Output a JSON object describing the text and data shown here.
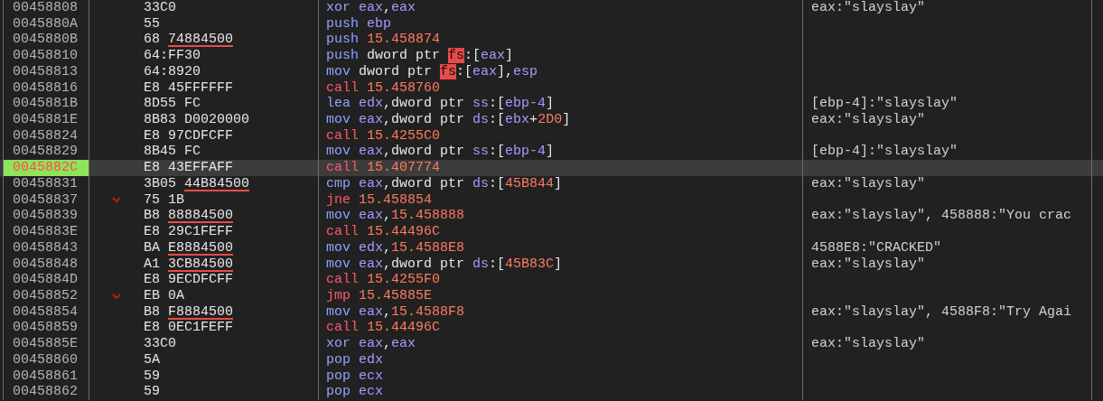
{
  "rows": [
    {
      "address": "00458808",
      "jump": false,
      "eip": false,
      "selected": false,
      "bytes": "33C0",
      "tokens": [
        {
          "kind": "mnem",
          "text": "xor "
        },
        {
          "kind": "reg",
          "text": "eax"
        },
        {
          "kind": "punct",
          "text": ","
        },
        {
          "kind": "reg",
          "text": "eax"
        }
      ],
      "comment": "eax:\"slayslay\""
    },
    {
      "address": "0045880A",
      "jump": false,
      "eip": false,
      "selected": false,
      "bytes": "55",
      "tokens": [
        {
          "kind": "mnem",
          "text": "push "
        },
        {
          "kind": "reg",
          "text": "ebp"
        }
      ]
    },
    {
      "address": "0045880B",
      "jump": false,
      "eip": false,
      "selected": false,
      "bytes": "68 ",
      "reloc": "74884500",
      "tokens": [
        {
          "kind": "mnem",
          "text": "push "
        },
        {
          "kind": "num",
          "text": "15.458874"
        }
      ]
    },
    {
      "address": "00458810",
      "jump": false,
      "eip": false,
      "selected": false,
      "bytes": "64:FF30",
      "tokens": [
        {
          "kind": "mnem",
          "text": "push "
        },
        {
          "kind": "ptr",
          "text": "dword ptr "
        },
        {
          "kind": "seg_alert",
          "text": "fs"
        },
        {
          "kind": "punct",
          "text": ":["
        },
        {
          "kind": "reg",
          "text": "eax"
        },
        {
          "kind": "punct",
          "text": "]"
        }
      ]
    },
    {
      "address": "00458813",
      "jump": false,
      "eip": false,
      "selected": false,
      "bytes": "64:8920",
      "tokens": [
        {
          "kind": "mnem",
          "text": "mov "
        },
        {
          "kind": "ptr",
          "text": "dword ptr "
        },
        {
          "kind": "seg_alert",
          "text": "fs"
        },
        {
          "kind": "punct",
          "text": ":["
        },
        {
          "kind": "reg",
          "text": "eax"
        },
        {
          "kind": "punct",
          "text": "],"
        },
        {
          "kind": "reg",
          "text": "esp"
        }
      ]
    },
    {
      "address": "00458816",
      "jump": false,
      "eip": false,
      "selected": false,
      "bytes": "E8 45FFFFFF",
      "tokens": [
        {
          "kind": "branch",
          "text": "call "
        },
        {
          "kind": "num",
          "text": "15.458760"
        }
      ]
    },
    {
      "address": "0045881B",
      "jump": false,
      "eip": false,
      "selected": false,
      "bytes": "8D55 FC",
      "tokens": [
        {
          "kind": "mnem",
          "text": "lea "
        },
        {
          "kind": "reg",
          "text": "edx"
        },
        {
          "kind": "punct",
          "text": ","
        },
        {
          "kind": "ptr",
          "text": "dword ptr "
        },
        {
          "kind": "seg",
          "text": "ss"
        },
        {
          "kind": "punct",
          "text": ":["
        },
        {
          "kind": "reg",
          "text": "ebp-4"
        },
        {
          "kind": "punct",
          "text": "]"
        }
      ],
      "comment": "[ebp-4]:\"slayslay\""
    },
    {
      "address": "0045881E",
      "jump": false,
      "eip": false,
      "selected": false,
      "bytes": "8B83 D0020000",
      "tokens": [
        {
          "kind": "mnem",
          "text": "mov "
        },
        {
          "kind": "reg",
          "text": "eax"
        },
        {
          "kind": "punct",
          "text": ","
        },
        {
          "kind": "ptr",
          "text": "dword ptr "
        },
        {
          "kind": "seg",
          "text": "ds"
        },
        {
          "kind": "punct",
          "text": ":["
        },
        {
          "kind": "reg",
          "text": "ebx"
        },
        {
          "kind": "punct",
          "text": "+"
        },
        {
          "kind": "num",
          "text": "2D0"
        },
        {
          "kind": "punct",
          "text": "]"
        }
      ],
      "comment": "eax:\"slayslay\""
    },
    {
      "address": "00458824",
      "jump": false,
      "eip": false,
      "selected": false,
      "bytes": "E8 97CDFCFF",
      "tokens": [
        {
          "kind": "branch",
          "text": "call "
        },
        {
          "kind": "num",
          "text": "15.4255C0"
        }
      ]
    },
    {
      "address": "00458829",
      "jump": false,
      "eip": false,
      "selected": false,
      "bytes": "8B45 FC",
      "tokens": [
        {
          "kind": "mnem",
          "text": "mov "
        },
        {
          "kind": "reg",
          "text": "eax"
        },
        {
          "kind": "punct",
          "text": ","
        },
        {
          "kind": "ptr",
          "text": "dword ptr "
        },
        {
          "kind": "seg",
          "text": "ss"
        },
        {
          "kind": "punct",
          "text": ":["
        },
        {
          "kind": "reg",
          "text": "ebp-4"
        },
        {
          "kind": "punct",
          "text": "]"
        }
      ],
      "comment": "[ebp-4]:\"slayslay\""
    },
    {
      "address": "0045882C",
      "jump": false,
      "eip": true,
      "selected": true,
      "bytes": "E8 43EFFAFF",
      "tokens": [
        {
          "kind": "branch",
          "text": "call "
        },
        {
          "kind": "num",
          "text": "15.407774"
        }
      ]
    },
    {
      "address": "00458831",
      "jump": false,
      "eip": false,
      "selected": false,
      "bytes": "3B05 ",
      "reloc": "44B84500",
      "tokens": [
        {
          "kind": "mnem",
          "text": "cmp "
        },
        {
          "kind": "reg",
          "text": "eax"
        },
        {
          "kind": "punct",
          "text": ","
        },
        {
          "kind": "ptr",
          "text": "dword ptr "
        },
        {
          "kind": "seg",
          "text": "ds"
        },
        {
          "kind": "punct",
          "text": ":["
        },
        {
          "kind": "num",
          "text": "45B844"
        },
        {
          "kind": "punct",
          "text": "]"
        }
      ],
      "comment": "eax:\"slayslay\""
    },
    {
      "address": "00458837",
      "jump": true,
      "eip": false,
      "selected": false,
      "bytes": "75 1B",
      "tokens": [
        {
          "kind": "branch",
          "text": "jne "
        },
        {
          "kind": "num",
          "text": "15.458854"
        }
      ]
    },
    {
      "address": "00458839",
      "jump": false,
      "eip": false,
      "selected": false,
      "bytes": "B8 ",
      "reloc": "88884500",
      "tokens": [
        {
          "kind": "mnem",
          "text": "mov "
        },
        {
          "kind": "reg",
          "text": "eax"
        },
        {
          "kind": "punct",
          "text": ","
        },
        {
          "kind": "num",
          "text": "15.458888"
        }
      ],
      "comment": "eax:\"slayslay\", 458888:\"You crac"
    },
    {
      "address": "0045883E",
      "jump": false,
      "eip": false,
      "selected": false,
      "bytes": "E8 29C1FEFF",
      "tokens": [
        {
          "kind": "branch",
          "text": "call "
        },
        {
          "kind": "num",
          "text": "15.44496C"
        }
      ]
    },
    {
      "address": "00458843",
      "jump": false,
      "eip": false,
      "selected": false,
      "bytes": "BA ",
      "reloc": "E8884500",
      "tokens": [
        {
          "kind": "mnem",
          "text": "mov "
        },
        {
          "kind": "reg",
          "text": "edx"
        },
        {
          "kind": "punct",
          "text": ","
        },
        {
          "kind": "num",
          "text": "15.4588E8"
        }
      ],
      "comment": "4588E8:\"CRACKED\""
    },
    {
      "address": "00458848",
      "jump": false,
      "eip": false,
      "selected": false,
      "bytes": "A1 ",
      "reloc": "3CB84500",
      "tokens": [
        {
          "kind": "mnem",
          "text": "mov "
        },
        {
          "kind": "reg",
          "text": "eax"
        },
        {
          "kind": "punct",
          "text": ","
        },
        {
          "kind": "ptr",
          "text": "dword ptr "
        },
        {
          "kind": "seg",
          "text": "ds"
        },
        {
          "kind": "punct",
          "text": ":["
        },
        {
          "kind": "num",
          "text": "45B83C"
        },
        {
          "kind": "punct",
          "text": "]"
        }
      ],
      "comment": "eax:\"slayslay\""
    },
    {
      "address": "0045884D",
      "jump": false,
      "eip": false,
      "selected": false,
      "bytes": "E8 9ECDFCFF",
      "tokens": [
        {
          "kind": "branch",
          "text": "call "
        },
        {
          "kind": "num",
          "text": "15.4255F0"
        }
      ]
    },
    {
      "address": "00458852",
      "jump": true,
      "eip": false,
      "selected": false,
      "bytes": "EB 0A",
      "tokens": [
        {
          "kind": "branch",
          "text": "jmp "
        },
        {
          "kind": "num",
          "text": "15.45885E"
        }
      ]
    },
    {
      "address": "00458854",
      "jump": false,
      "eip": false,
      "selected": false,
      "bytes": "B8 ",
      "reloc": "F8884500",
      "tokens": [
        {
          "kind": "mnem",
          "text": "mov "
        },
        {
          "kind": "reg",
          "text": "eax"
        },
        {
          "kind": "punct",
          "text": ","
        },
        {
          "kind": "num",
          "text": "15.4588F8"
        }
      ],
      "comment": "eax:\"slayslay\", 4588F8:\"Try Agai"
    },
    {
      "address": "00458859",
      "jump": false,
      "eip": false,
      "selected": false,
      "bytes": "E8 0EC1FEFF",
      "tokens": [
        {
          "kind": "branch",
          "text": "call "
        },
        {
          "kind": "num",
          "text": "15.44496C"
        }
      ]
    },
    {
      "address": "0045885E",
      "jump": false,
      "eip": false,
      "selected": false,
      "bytes": "33C0",
      "tokens": [
        {
          "kind": "mnem",
          "text": "xor "
        },
        {
          "kind": "reg",
          "text": "eax"
        },
        {
          "kind": "punct",
          "text": ","
        },
        {
          "kind": "reg",
          "text": "eax"
        }
      ],
      "comment": "eax:\"slayslay\""
    },
    {
      "address": "00458860",
      "jump": false,
      "eip": false,
      "selected": false,
      "bytes": "5A",
      "tokens": [
        {
          "kind": "mnem",
          "text": "pop "
        },
        {
          "kind": "reg",
          "text": "edx"
        }
      ]
    },
    {
      "address": "00458861",
      "jump": false,
      "eip": false,
      "selected": false,
      "bytes": "59",
      "tokens": [
        {
          "kind": "mnem",
          "text": "pop "
        },
        {
          "kind": "reg",
          "text": "ecx"
        }
      ]
    },
    {
      "address": "00458862",
      "jump": false,
      "eip": false,
      "selected": false,
      "bytes": "59",
      "tokens": [
        {
          "kind": "mnem",
          "text": "pop "
        },
        {
          "kind": "reg",
          "text": "ecx"
        }
      ]
    }
  ]
}
